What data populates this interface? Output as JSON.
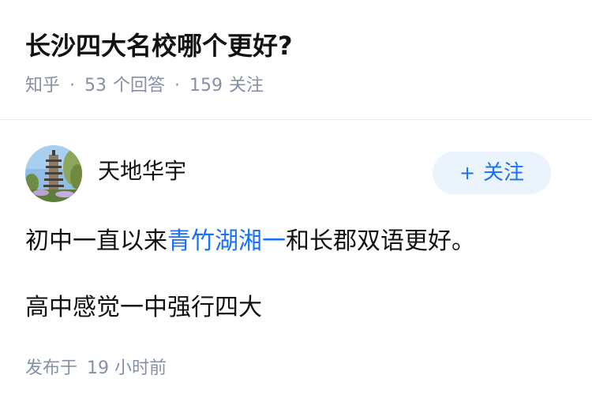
{
  "question": {
    "title": "长沙四大名校哪个更好?",
    "source": "知乎",
    "answers_count": "53",
    "answers_label": "个回答",
    "followers_count": "159",
    "followers_label": "关注",
    "separator": "·"
  },
  "author": {
    "name": "天地华宇",
    "follow_plus": "+",
    "follow_label": "关注"
  },
  "answer": {
    "p1_before": "初中一直以来",
    "p1_link": "青竹湖湘一",
    "p1_after": "和长郡双语更好。",
    "p2": "高中感觉一中强行四大",
    "publish_label": "发布于",
    "publish_time": "19 小时前"
  },
  "colors": {
    "link": "#1772f6",
    "meta": "#8590a6",
    "follow_bg": "#ebf3fc"
  }
}
